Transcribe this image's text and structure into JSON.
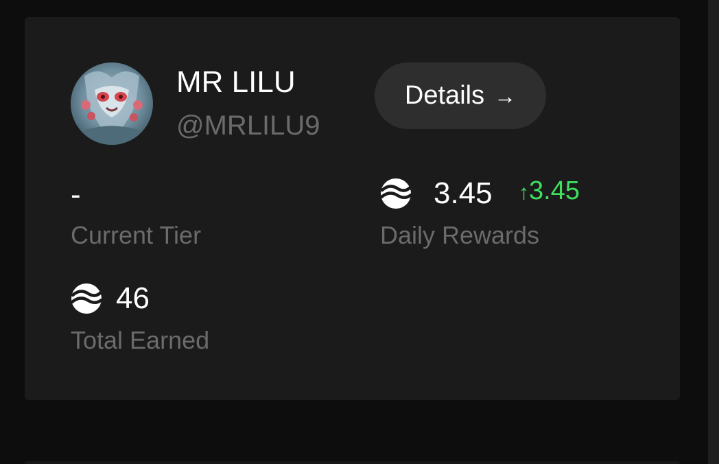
{
  "profile": {
    "name": "MR LILU",
    "handle": "@MRLILU9",
    "details_label": "Details",
    "details_arrow": "→"
  },
  "stats": {
    "current_tier": {
      "value": "-",
      "label": "Current Tier"
    },
    "daily_rewards": {
      "value": "3.45",
      "delta_arrow": "↑",
      "delta": "3.45",
      "label": "Daily Rewards",
      "icon": "coin-icon"
    },
    "total_earned": {
      "value": "46",
      "label": "Total Earned",
      "icon": "coin-icon"
    }
  },
  "colors": {
    "background": "#0d0d0d",
    "card": "#1b1b1b",
    "button": "#2e2e2e",
    "text_primary": "#ffffff",
    "text_secondary": "#6b6b6b",
    "positive": "#3ee05e"
  }
}
